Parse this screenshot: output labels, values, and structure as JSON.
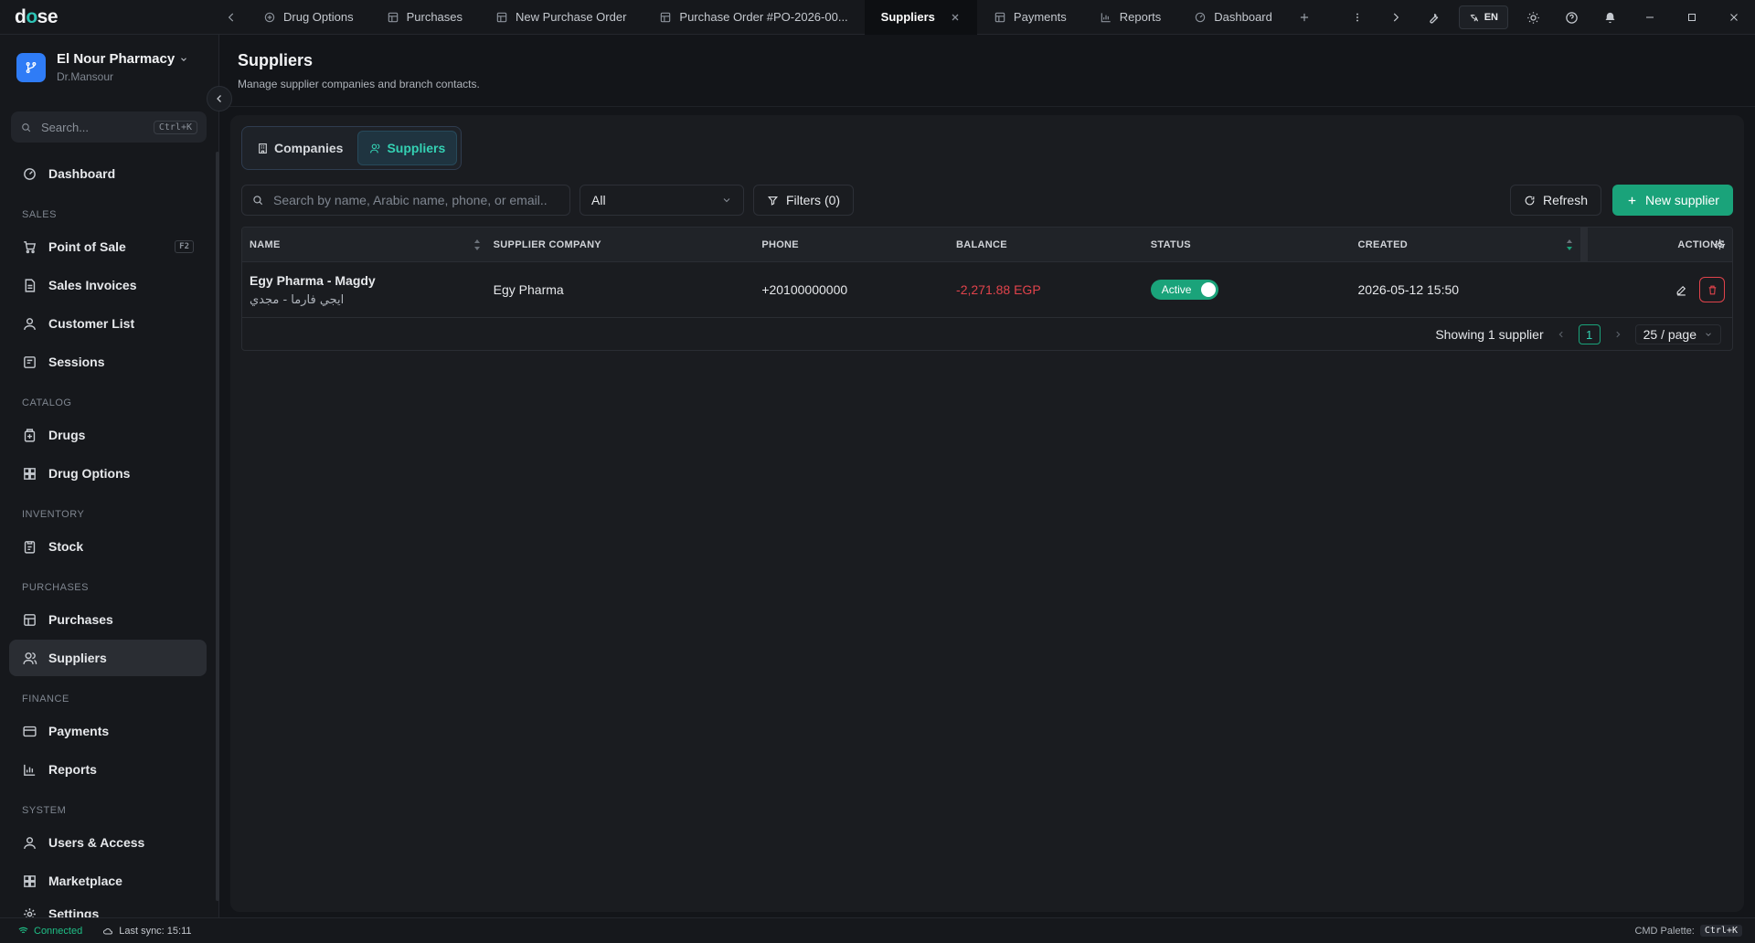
{
  "app": {
    "logo_prefix": "d",
    "logo_accent": "o",
    "logo_suffix": "se",
    "accent_color": "#1aa37a",
    "danger_color": "#e0434b"
  },
  "tabs": [
    {
      "label": "Drug Options",
      "icon": "grid-icon"
    },
    {
      "label": "Purchases",
      "icon": "table-icon"
    },
    {
      "label": "New Purchase Order",
      "icon": "table-icon"
    },
    {
      "label": "Purchase Order #PO-2026-00...",
      "icon": "table-icon"
    },
    {
      "label": "Suppliers",
      "active": true
    },
    {
      "label": "Payments",
      "icon": "table-icon"
    },
    {
      "label": "Reports",
      "icon": "chart-icon"
    },
    {
      "label": "Dashboard",
      "icon": "gauge-icon"
    }
  ],
  "titlebar": {
    "lang": "EN"
  },
  "org": {
    "name": "El Nour Pharmacy",
    "user": "Dr.Mansour"
  },
  "sidebar": {
    "search_placeholder": "Search...",
    "search_shortcut": "Ctrl+K",
    "dashboard": "Dashboard",
    "sections": {
      "sales": "SALES",
      "catalog": "CATALOG",
      "inventory": "INVENTORY",
      "purchases": "PURCHASES",
      "finance": "FINANCE",
      "system": "SYSTEM"
    },
    "items": {
      "pos": "Point of Sale",
      "pos_key": "F2",
      "sales_invoices": "Sales Invoices",
      "customer_list": "Customer List",
      "sessions": "Sessions",
      "drugs": "Drugs",
      "drug_options": "Drug Options",
      "stock": "Stock",
      "purchases": "Purchases",
      "suppliers": "Suppliers",
      "payments": "Payments",
      "reports": "Reports",
      "users": "Users & Access",
      "marketplace": "Marketplace",
      "settings": "Settings"
    }
  },
  "page": {
    "title": "Suppliers",
    "subtitle": "Manage supplier companies and branch contacts."
  },
  "segments": {
    "companies": "Companies",
    "suppliers": "Suppliers"
  },
  "toolbar": {
    "search_placeholder": "Search by name, Arabic name, phone, or email...",
    "status_value": "All",
    "filters": "Filters (0)",
    "refresh": "Refresh",
    "new_supplier": "New supplier"
  },
  "table": {
    "columns": [
      "NAME",
      "SUPPLIER COMPANY",
      "PHONE",
      "BALANCE",
      "STATUS",
      "CREATED",
      "ACTIONS"
    ],
    "rows": [
      {
        "name": "Egy Pharma - Magdy",
        "name_ar": "ايجي فارما - مجدي",
        "company": "Egy Pharma",
        "phone": "+20100000000",
        "balance": "-2,271.88 EGP",
        "status": "Active",
        "created": "2026-05-12 15:50"
      }
    ],
    "pagination": {
      "summary": "Showing 1 supplier",
      "page": "1",
      "per_page": "25 / page"
    }
  },
  "statusbar": {
    "connection": "Connected",
    "last_sync": "Last sync: 15:11",
    "cmd_label": "CMD Palette:",
    "cmd_key": "Ctrl+K"
  }
}
